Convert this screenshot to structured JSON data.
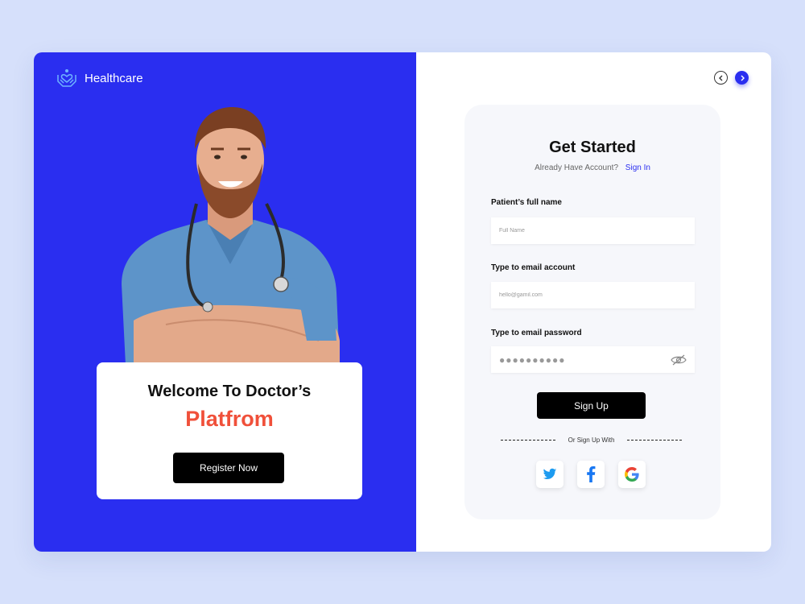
{
  "brand": {
    "name": "Healthcare"
  },
  "welcome": {
    "line1": "Welcome  To Doctor’s",
    "line2": "Platfrom",
    "button": "Register Now"
  },
  "form": {
    "title": "Get Started",
    "account_prompt": "Already Have Account?",
    "signin_link": "Sign In",
    "fields": [
      {
        "label": "Patient’s full name",
        "placeholder": "Full Name"
      },
      {
        "label": "Type to  email account",
        "placeholder": "hello@gamil.com"
      },
      {
        "label": "Type to  email password",
        "masked_value": "●●●●●●●●●●"
      }
    ],
    "signup_button": "Sign Up",
    "or_text": "Or Sign Up With",
    "social": [
      "twitter-icon",
      "facebook-icon",
      "google-icon"
    ]
  },
  "colors": {
    "primary": "#2a2ef0",
    "accent": "#f0503a",
    "background": "#d6e0fb"
  }
}
